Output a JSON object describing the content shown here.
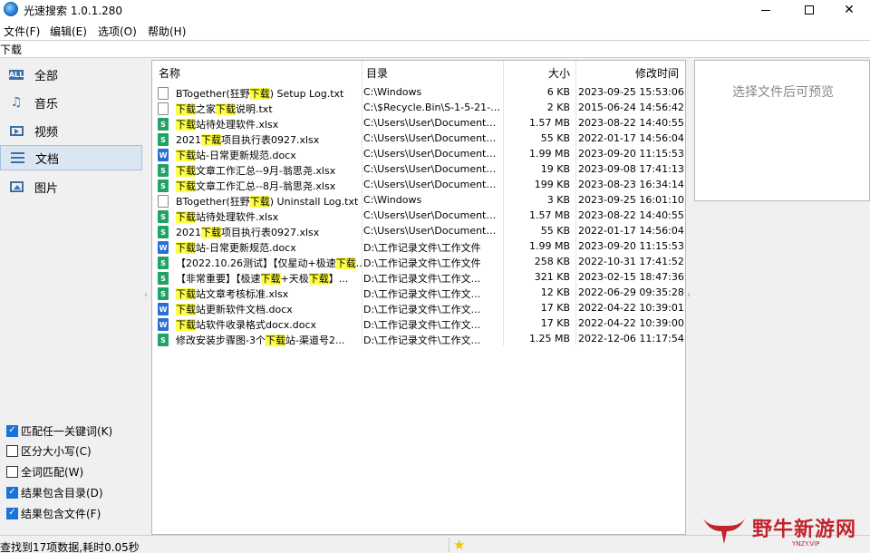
{
  "window": {
    "title": "光速搜索 1.0.1.280"
  },
  "menu": [
    "文件(F)",
    "编辑(E)",
    "选项(O)",
    "帮助(H)"
  ],
  "search": {
    "value": "下载"
  },
  "categories": [
    {
      "label": "全部",
      "icon": "all-icon"
    },
    {
      "label": "音乐",
      "icon": "music-icon"
    },
    {
      "label": "视频",
      "icon": "video-icon"
    },
    {
      "label": "文档",
      "icon": "document-icon",
      "active": true
    },
    {
      "label": "图片",
      "icon": "picture-icon"
    }
  ],
  "options": [
    {
      "label": "匹配任一关键词(K)",
      "checked": true
    },
    {
      "label": "区分大小写(C)",
      "checked": false
    },
    {
      "label": "全词匹配(W)",
      "checked": false
    },
    {
      "label": "结果包含目录(D)",
      "checked": true
    },
    {
      "label": "结果包含文件(F)",
      "checked": true
    }
  ],
  "columns": {
    "name": "名称",
    "dir": "目录",
    "size": "大小",
    "time": "修改时间"
  },
  "rows": [
    {
      "type": "txt",
      "name": "BTogether(狂野下载) Setup Log.txt",
      "dir": "C:\\Windows",
      "size": "6 KB",
      "time": "2023-09-25 15:53:06"
    },
    {
      "type": "txt",
      "name": "下载之家下载说明.txt",
      "dir": "C:\\$Recycle.Bin\\S-1-5-21-26...",
      "size": "2 KB",
      "time": "2015-06-24 14:56:42"
    },
    {
      "type": "xlsx",
      "name": "下载站待处理软件.xlsx",
      "dir": "C:\\Users\\User\\Documents\\...",
      "size": "1.57 MB",
      "time": "2023-08-22 14:40:55"
    },
    {
      "type": "xlsx",
      "name": "2021下载项目执行表0927.xlsx",
      "dir": "C:\\Users\\User\\Documents\\...",
      "size": "55 KB",
      "time": "2022-01-17 14:56:04"
    },
    {
      "type": "docx",
      "name": "下载站-日常更新规范.docx",
      "dir": "C:\\Users\\User\\Documents\\...",
      "size": "1.99 MB",
      "time": "2023-09-20 11:15:53"
    },
    {
      "type": "xlsx",
      "name": "下载文章工作汇总--9月-翁思尧.xlsx",
      "dir": "C:\\Users\\User\\Documents\\...",
      "size": "19 KB",
      "time": "2023-09-08 17:41:13"
    },
    {
      "type": "xlsx",
      "name": "下载文章工作汇总--8月-翁思尧.xlsx",
      "dir": "C:\\Users\\User\\Documents\\...",
      "size": "199 KB",
      "time": "2023-08-23 16:34:14"
    },
    {
      "type": "txt",
      "name": "BTogether(狂野下载) Uninstall Log.txt",
      "dir": "C:\\Windows",
      "size": "3 KB",
      "time": "2023-09-25 16:01:10"
    },
    {
      "type": "xlsx",
      "name": "下载站待处理软件.xlsx",
      "dir": "C:\\Users\\User\\Documents\\...",
      "size": "1.57 MB",
      "time": "2023-08-22 14:40:55"
    },
    {
      "type": "xlsx",
      "name": "2021下载项目执行表0927.xlsx",
      "dir": "C:\\Users\\User\\Documents\\...",
      "size": "55 KB",
      "time": "2022-01-17 14:56:04"
    },
    {
      "type": "docx",
      "name": "下载站-日常更新规范.docx",
      "dir": "D:\\工作记录文件\\工作文件",
      "size": "1.99 MB",
      "time": "2023-09-20 11:15:53"
    },
    {
      "type": "xlsx",
      "name": "【2022.10.26测试】【仅星动+极速下载...",
      "dir": "D:\\工作记录文件\\工作文件",
      "size": "258 KB",
      "time": "2022-10-31 17:41:52"
    },
    {
      "type": "xlsx",
      "name": "【非常重要】【极速下载+天极下载】...",
      "dir": "D:\\工作记录文件\\工作文...",
      "size": "321 KB",
      "time": "2023-02-15 18:47:36"
    },
    {
      "type": "xlsx",
      "name": "下载站文章考核标准.xlsx",
      "dir": "D:\\工作记录文件\\工作文...",
      "size": "12 KB",
      "time": "2022-06-29 09:35:28"
    },
    {
      "type": "docx",
      "name": "下载站更新软件文档.docx",
      "dir": "D:\\工作记录文件\\工作文...",
      "size": "17 KB",
      "time": "2022-04-22 10:39:01"
    },
    {
      "type": "docx",
      "name": "下载站软件收录格式docx.docx",
      "dir": "D:\\工作记录文件\\工作文...",
      "size": "17 KB",
      "time": "2022-04-22 10:39:00"
    },
    {
      "type": "xlsx",
      "name": "修改安装步骤图-3个下载站-渠道号2...",
      "dir": "D:\\工作记录文件\\工作文...",
      "size": "1.25 MB",
      "time": "2022-12-06 11:17:54"
    }
  ],
  "highlight_keyword": "下载",
  "preview": {
    "text": "选择文件后可预览"
  },
  "status": {
    "text": "查找到17项数据,耗时0.05秒"
  },
  "watermark": {
    "text": "野牛新游网",
    "url": "YNZY.VIP"
  },
  "colors": {
    "highlight": "#ffff44",
    "accent": "#1a73d9",
    "watermark": "#c0242c"
  }
}
